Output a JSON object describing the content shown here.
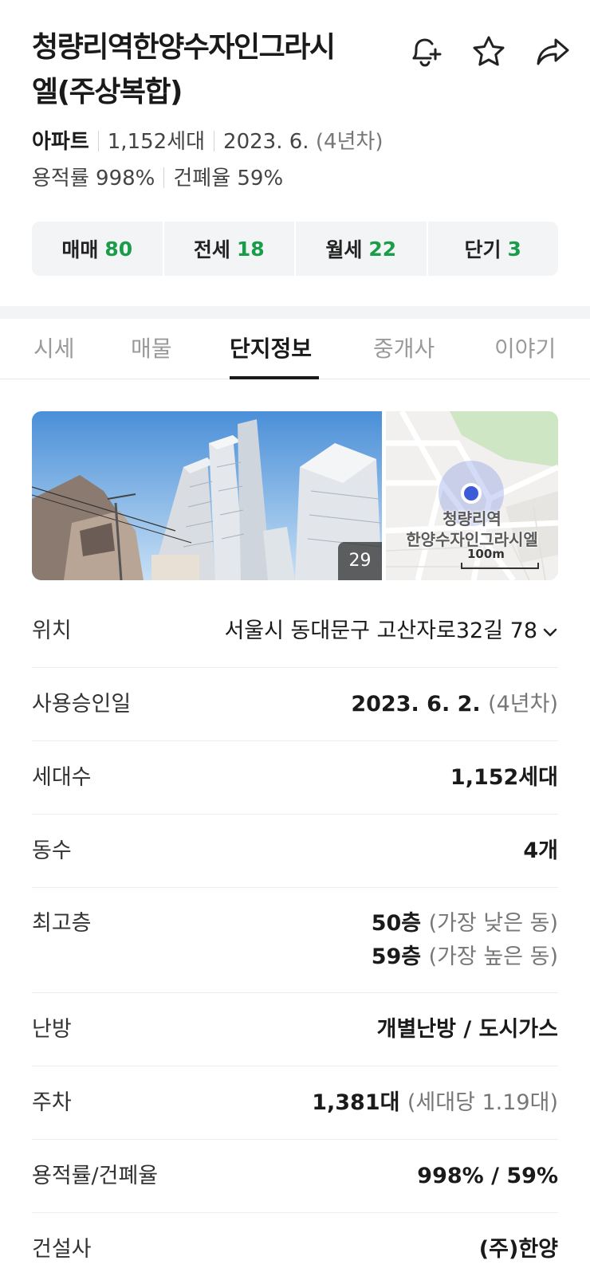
{
  "header": {
    "title_line1": "청량리역한양수자인그라시",
    "title_line2": "엘(주상복합)",
    "icons": [
      "bell-plus-icon",
      "star-icon",
      "share-icon"
    ]
  },
  "summary": {
    "type": "아파트",
    "households": "1,152세대",
    "completion": "2023. 6.",
    "age": "(4년차)",
    "far": "용적률 998%",
    "bcr": "건폐율 59%"
  },
  "deals": [
    {
      "label": "매매",
      "count": "80"
    },
    {
      "label": "전세",
      "count": "18"
    },
    {
      "label": "월세",
      "count": "22"
    },
    {
      "label": "단기",
      "count": "3"
    }
  ],
  "tabs": [
    {
      "label": "시세"
    },
    {
      "label": "매물"
    },
    {
      "label": "단지정보",
      "active": true
    },
    {
      "label": "중개사"
    },
    {
      "label": "이야기"
    }
  ],
  "media": {
    "photo_count": "29",
    "map_label_line1": "청량리역",
    "map_label_line2": "한양수자인그라시엘",
    "map_scale": "100m"
  },
  "info": {
    "location": {
      "label": "위치",
      "value": "서울시 동대문구 고산자로32길 78"
    },
    "approval": {
      "label": "사용승인일",
      "value": "2023. 6. 2.",
      "sub": "(4년차)"
    },
    "households": {
      "label": "세대수",
      "value": "1,152세대"
    },
    "buildings": {
      "label": "동수",
      "value": "4개"
    },
    "floors": {
      "label": "최고층",
      "low": "50층",
      "low_sub": "(가장 낮은 동)",
      "high": "59층",
      "high_sub": "(가장 높은 동)"
    },
    "heating": {
      "label": "난방",
      "value": "개별난방 / 도시가스"
    },
    "parking": {
      "label": "주차",
      "value": "1,381대",
      "sub": "(세대당 1.19대)"
    },
    "ratio": {
      "label": "용적률/건폐율",
      "value": "998% / 59%"
    },
    "builder": {
      "label": "건설사",
      "value": "(주)한양"
    }
  },
  "colors": {
    "accent_green": "#1a9c4a",
    "map_pin": "#3d5bd9"
  }
}
